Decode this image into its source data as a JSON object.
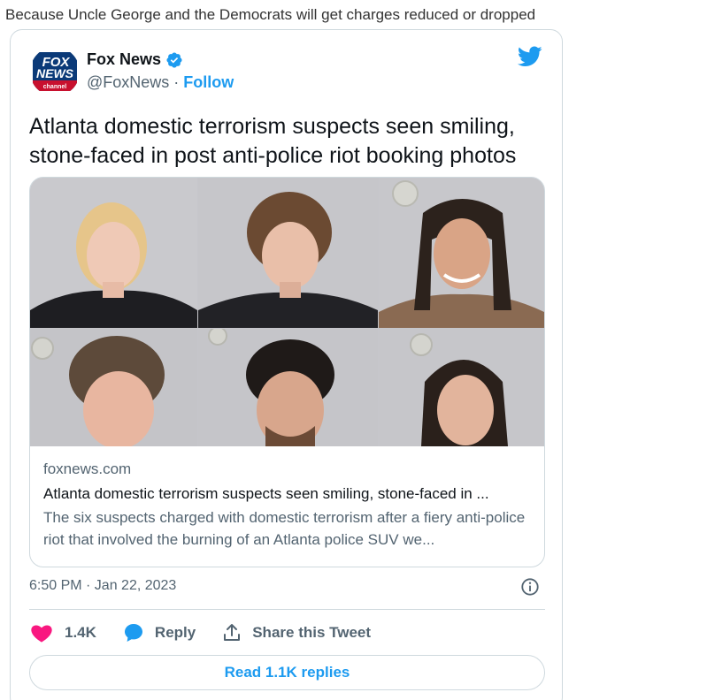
{
  "caption": "Because Uncle George and the Democrats will get charges reduced or dropped",
  "tweet": {
    "author_name": "Fox News",
    "author_handle": "@FoxNews",
    "separator": " · ",
    "follow_label": "Follow",
    "headline": "Atlanta domestic terrorism suspects seen smiling, stone-faced in post anti-police riot booking photos",
    "card": {
      "domain": "foxnews.com",
      "title": "Atlanta domestic terrorism suspects seen smiling, stone-faced in ...",
      "description": "The six suspects charged with domestic terrorism after a fiery anti-police riot that involved the burning of an Atlanta police SUV we..."
    },
    "timestamp": "6:50 PM · Jan 22, 2023",
    "actions": {
      "like_count": "1.4K",
      "reply_label": "Reply",
      "share_label": "Share this Tweet"
    },
    "read_replies_label": "Read 1.1K replies"
  },
  "logo": {
    "text_line1": "FOX",
    "text_line2": "NEWS",
    "text_line3": "channel"
  },
  "icons": {
    "verified": "verified-badge-icon",
    "twitter": "twitter-bird-icon",
    "info": "info-icon",
    "like": "heart-icon",
    "reply": "speech-bubble-icon",
    "share": "share-upload-icon"
  },
  "colors": {
    "accent": "#1d9bf0",
    "like": "#f91880",
    "text_primary": "#0f1419",
    "text_secondary": "#536471",
    "border": "#cfd9de",
    "logo_blue": "#003366",
    "logo_red": "#c8102e"
  }
}
